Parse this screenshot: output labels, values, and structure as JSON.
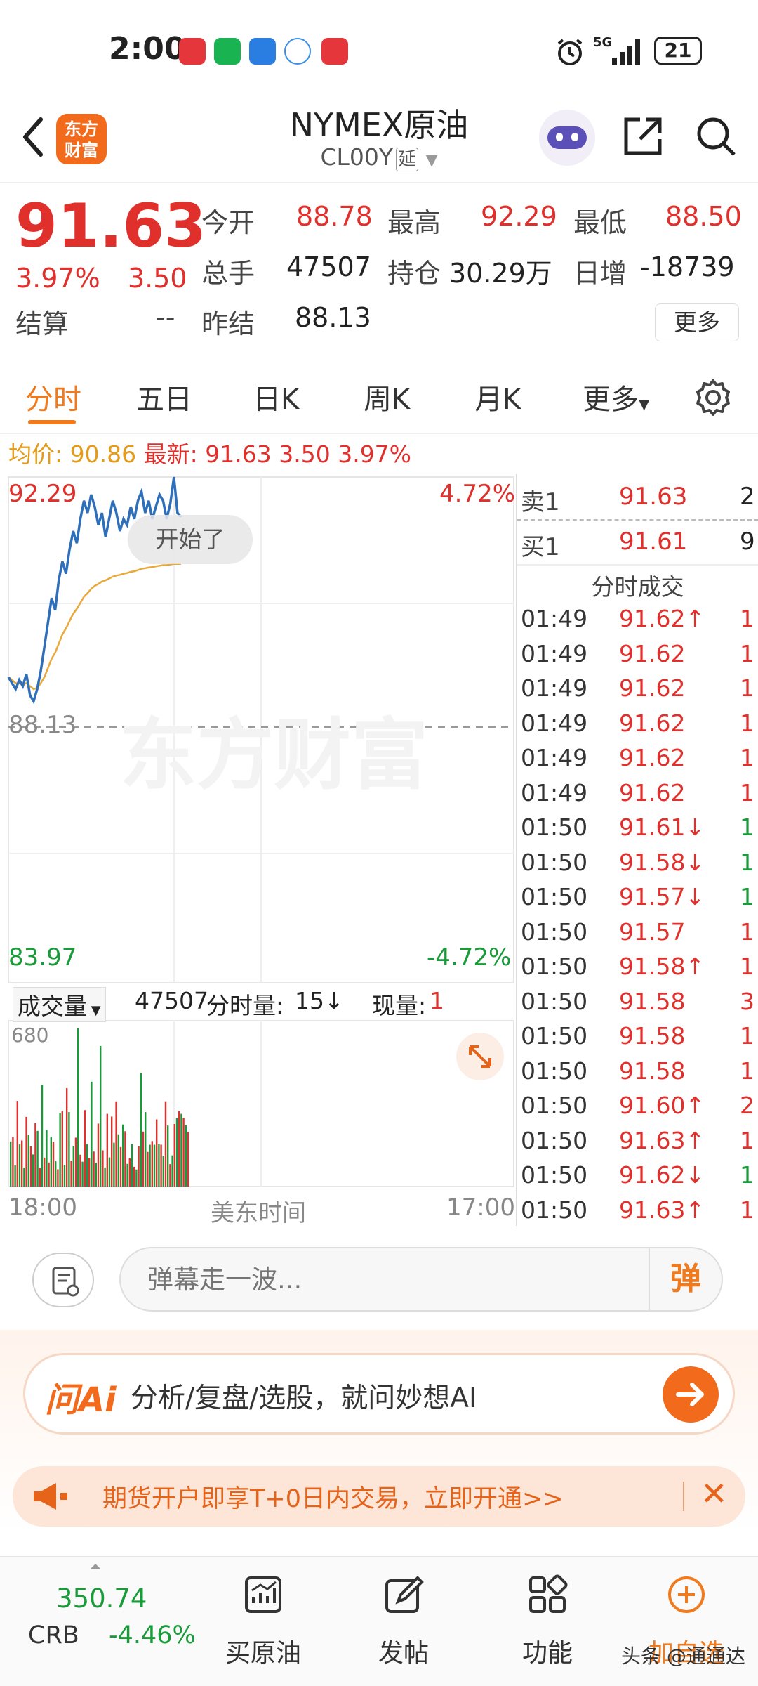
{
  "status": {
    "time": "2:00",
    "network": "5G",
    "battery": "21"
  },
  "nav": {
    "title": "NYMEX原油",
    "code": "CL00Y",
    "delay_tag": "延",
    "logo_text_1": "东方",
    "logo_text_2": "财富"
  },
  "quote": {
    "price": "91.63",
    "change_pct": "3.97%",
    "change": "3.50",
    "open_label": "今开",
    "open": "88.78",
    "high_label": "最高",
    "high": "92.29",
    "low_label": "最低",
    "low": "88.50",
    "volume_label": "总手",
    "volume": "47507",
    "oi_label": "持仓",
    "oi": "30.29万",
    "daily_inc_label": "日增",
    "daily_inc": "-18739",
    "settle_label": "结算",
    "settle": "--",
    "prev_settle_label": "昨结",
    "prev_settle": "88.13",
    "more_label": "更多"
  },
  "tabs": [
    "分时",
    "五日",
    "日K",
    "周K",
    "月K",
    "更多"
  ],
  "avg": {
    "avg_label": "均价:",
    "avg_value": "90.86",
    "latest_label": "最新:",
    "latest": "91.63",
    "chg": "3.50",
    "pct": "3.97%"
  },
  "chart": {
    "y_top": "92.29",
    "y_top_pct": "4.72%",
    "y_mid": "88.13",
    "y_bottom": "83.97",
    "y_bottom_pct": "-4.72%",
    "tooltip": "开始了",
    "watermark": "东方财富",
    "vol_selector": "成交量",
    "vol_total": "47507",
    "vol_period_label": "分时量:",
    "vol_period": "15",
    "vol_now_label": "现量:",
    "vol_now": "1",
    "vol_axis_max": "680",
    "x_start": "18:00",
    "x_mid": "美东时间",
    "x_end": "17:00"
  },
  "chart_data": {
    "type": "line",
    "ylim": [
      83.97,
      92.29
    ],
    "series": [
      {
        "values": [
          89.0,
          88.9,
          88.8,
          88.95,
          88.85,
          89.05,
          88.7,
          88.6,
          88.8,
          89.1,
          89.5,
          89.9,
          90.3,
          90.1,
          90.6,
          90.9,
          90.7,
          91.1,
          91.4,
          91.2,
          91.6,
          91.9,
          91.7,
          92.0,
          91.8,
          91.5,
          91.7,
          91.3,
          91.6,
          91.9,
          91.7,
          91.4,
          91.6,
          91.5,
          91.8,
          91.6,
          91.9,
          92.05,
          91.7,
          91.9,
          91.6,
          91.8,
          92.0,
          91.9,
          91.6,
          91.85,
          92.29,
          91.7,
          91.63
        ]
      },
      {
        "values": [
          89.0,
          88.95,
          88.9,
          88.9,
          88.88,
          88.9,
          88.85,
          88.8,
          88.82,
          88.9,
          89.0,
          89.15,
          89.3,
          89.4,
          89.55,
          89.7,
          89.8,
          89.92,
          90.04,
          90.12,
          90.22,
          90.32,
          90.38,
          90.45,
          90.5,
          90.53,
          90.57,
          90.59,
          90.62,
          90.65,
          90.67,
          90.68,
          90.7,
          90.71,
          90.73,
          90.74,
          90.76,
          90.78,
          90.79,
          90.8,
          90.81,
          90.82,
          90.83,
          90.84,
          90.84,
          90.85,
          90.86,
          90.86,
          90.86
        ]
      }
    ]
  },
  "orderbook": [
    {
      "label": "卖1",
      "price": "91.63",
      "vol": "2"
    },
    {
      "label": "买1",
      "price": "91.61",
      "vol": "9"
    }
  ],
  "ticks_title": "分时成交",
  "ticks": [
    {
      "t": "01:49",
      "p": "91.62↑",
      "v": "1",
      "dir": "up"
    },
    {
      "t": "01:49",
      "p": "91.62",
      "v": "1",
      "dir": "none"
    },
    {
      "t": "01:49",
      "p": "91.62",
      "v": "1",
      "dir": "none"
    },
    {
      "t": "01:49",
      "p": "91.62",
      "v": "1",
      "dir": "none"
    },
    {
      "t": "01:49",
      "p": "91.62",
      "v": "1",
      "dir": "none"
    },
    {
      "t": "01:49",
      "p": "91.62",
      "v": "1",
      "dir": "none"
    },
    {
      "t": "01:50",
      "p": "91.61↓",
      "v": "1",
      "dir": "down"
    },
    {
      "t": "01:50",
      "p": "91.58↓",
      "v": "1",
      "dir": "down"
    },
    {
      "t": "01:50",
      "p": "91.57↓",
      "v": "1",
      "dir": "down"
    },
    {
      "t": "01:50",
      "p": "91.57",
      "v": "1",
      "dir": "none"
    },
    {
      "t": "01:50",
      "p": "91.58↑",
      "v": "1",
      "dir": "up"
    },
    {
      "t": "01:50",
      "p": "91.58",
      "v": "3",
      "dir": "none"
    },
    {
      "t": "01:50",
      "p": "91.58",
      "v": "1",
      "dir": "none"
    },
    {
      "t": "01:50",
      "p": "91.58",
      "v": "1",
      "dir": "none"
    },
    {
      "t": "01:50",
      "p": "91.60↑",
      "v": "2",
      "dir": "up"
    },
    {
      "t": "01:50",
      "p": "91.63↑",
      "v": "1",
      "dir": "up"
    },
    {
      "t": "01:50",
      "p": "91.62↓",
      "v": "1",
      "dir": "down"
    },
    {
      "t": "01:50",
      "p": "91.63↑",
      "v": "1",
      "dir": "up"
    }
  ],
  "comment": {
    "placeholder": "弹幕走一波...",
    "danmu_btn": "弹"
  },
  "ai": {
    "logo": "问Ai",
    "text": "分析/复盘/选股，就问妙想AI"
  },
  "promo": {
    "text": "期货开户即享T+0日内交易，立即开通>>"
  },
  "bottom": {
    "index_value": "350.74",
    "index_name": "CRB",
    "index_pct": "-4.46%",
    "items": [
      "买原油",
      "发帖",
      "功能",
      "加自选"
    ]
  },
  "footer_watermark": "头条 @通通达",
  "colors": {
    "up": "#e0302c",
    "down": "#1a9b3a",
    "accent": "#f07a1e",
    "price_line": "#2f6fba",
    "avg_line": "#e8a93a"
  }
}
